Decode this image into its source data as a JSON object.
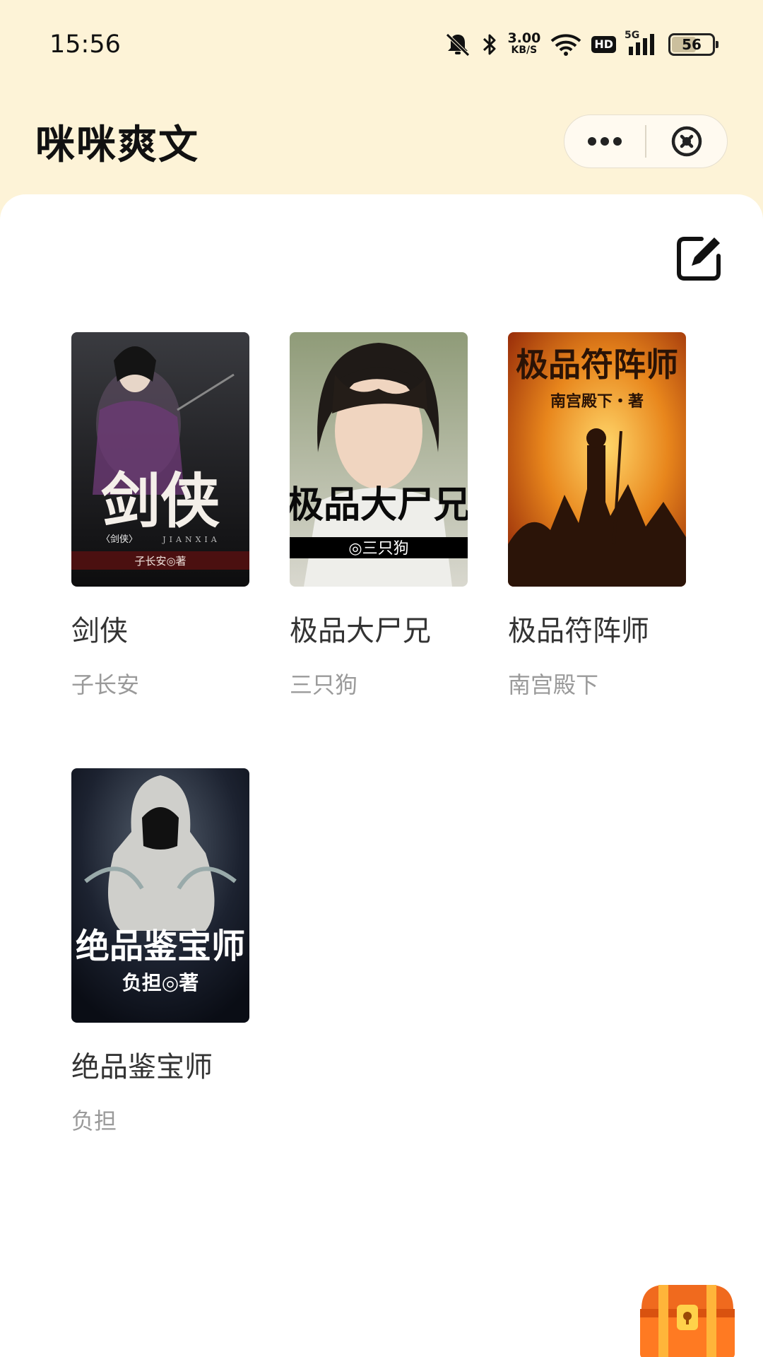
{
  "status_bar": {
    "time": "15:56",
    "net_speed_value": "3.00",
    "net_speed_unit": "KB/S",
    "hd_label": "HD",
    "network_label": "5G",
    "battery": "56",
    "icons": [
      "mute-icon",
      "bluetooth-icon",
      "wifi-icon",
      "signal-icon",
      "battery-icon"
    ]
  },
  "header": {
    "title": "咪咪爽文",
    "more_icon": "more-dots-icon",
    "close_icon": "close-circle-icon"
  },
  "toolbar": {
    "edit_icon": "edit-icon"
  },
  "books": [
    {
      "title": "剑侠",
      "author": "子长安",
      "cover": {
        "big_text": "剑侠",
        "sub_text": "〈剑侠〉",
        "pinyin": "JIANXIA",
        "byline": "子长安◎著",
        "bg": "#2b2b2e",
        "accent": "#c01a1a"
      }
    },
    {
      "title": "极品大尸兄",
      "author": "三只狗",
      "cover": {
        "big_text": "极品大尸兄",
        "byline": "◎三只狗",
        "bg": "#b9b8a4",
        "accent": "#000000"
      }
    },
    {
      "title": "极品符阵师",
      "author": "南宫殿下",
      "cover": {
        "big_text": "极品符阵师",
        "byline": "南宫殿下・著",
        "bg": "#e08a1e",
        "accent": "#3a1e0a"
      }
    },
    {
      "title": "绝品鉴宝师",
      "author": "负担",
      "cover": {
        "big_text": "绝品鉴宝师",
        "byline": "负担◎著",
        "bg": "#181d2a",
        "accent": "#ffffff"
      }
    }
  ],
  "floating": {
    "gift_icon": "treasure-chest-icon"
  },
  "colors": {
    "header_bg": "#fdf3d7",
    "content_bg": "#ffffff",
    "title_text": "#333333",
    "author_text": "#9a9a9a"
  }
}
